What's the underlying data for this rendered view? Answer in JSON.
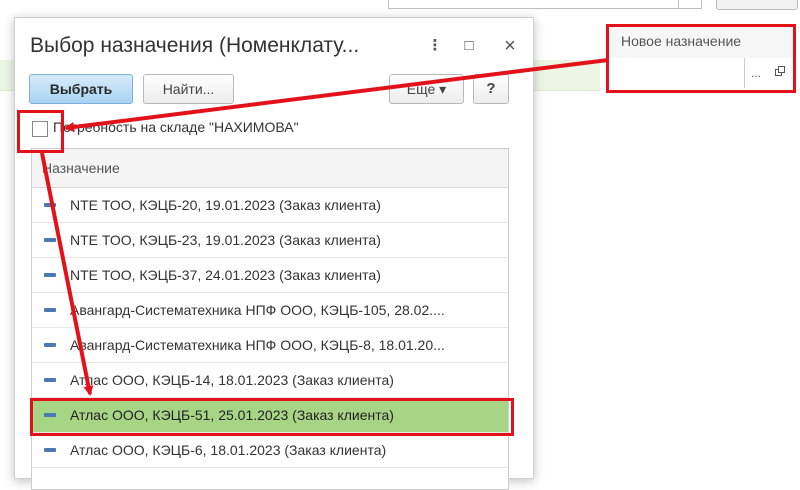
{
  "field": {
    "label": "Новое назначение",
    "dots": "...",
    "open_icon": "open-window-icon"
  },
  "dialog": {
    "title": "Выбор назначения (Номенклату...",
    "kebab": "⋮",
    "maximize": "□",
    "close": "×"
  },
  "toolbar": {
    "select_label": "Выбрать",
    "find_label": "Найти...",
    "more_label": "Еще ▾",
    "help_label": "?"
  },
  "filter": {
    "checkbox_label": "Потребность на складе \"НАХИМОВА\"",
    "checked": false
  },
  "list": {
    "column_header": "Назначение",
    "selected_index": 6,
    "rows": [
      "NTE ТОО, КЭЦБ-20, 19.01.2023 (Заказ клиента)",
      "NTE ТОО, КЭЦБ-23, 19.01.2023 (Заказ клиента)",
      "NTE ТОО, КЭЦБ-37, 24.01.2023 (Заказ клиента)",
      "Авангард-Систематехника НПФ ООО, КЭЦБ-105, 28.02....",
      "Авангард-Систематехника НПФ ООО, КЭЦБ-8, 18.01.20...",
      "Атлас ООО, КЭЦБ-14, 18.01.2023 (Заказ клиента)",
      "Атлас ООО, КЭЦБ-51, 25.01.2023 (Заказ клиента)",
      "Атлас ООО, КЭЦБ-6, 18.01.2023 (Заказ клиента)"
    ]
  },
  "colors": {
    "annotation_red": "#e3121a",
    "selected_row": "#a6d585",
    "primary_button": "#a9d3f2"
  }
}
